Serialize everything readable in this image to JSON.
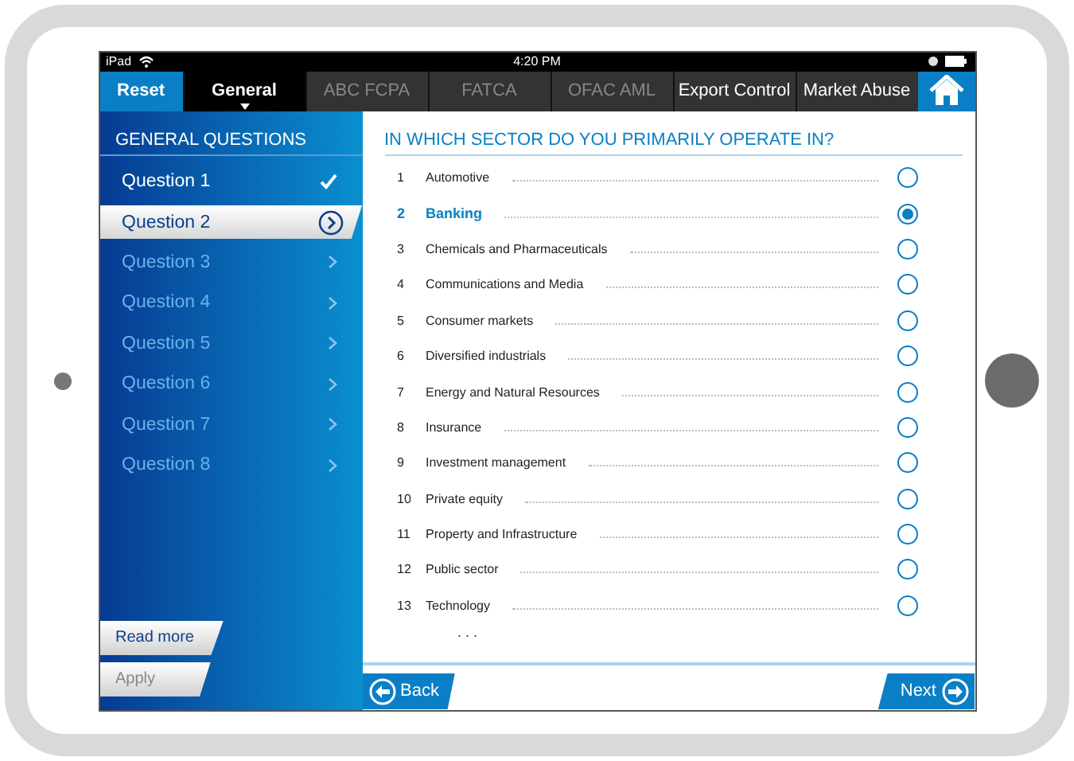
{
  "status_bar": {
    "device": "iPad",
    "time": "4:20 PM"
  },
  "nav": {
    "reset": "Reset",
    "tabs": [
      {
        "label": "General",
        "selected": true,
        "disabled": false
      },
      {
        "label": "ABC FCPA",
        "selected": false,
        "disabled": true
      },
      {
        "label": "FATCA",
        "selected": false,
        "disabled": true
      },
      {
        "label": "OFAC AML",
        "selected": false,
        "disabled": true
      },
      {
        "label": "Export Control",
        "selected": false,
        "disabled": false
      },
      {
        "label": "Market Abuse",
        "selected": false,
        "disabled": false
      }
    ]
  },
  "sidebar": {
    "title": "GENERAL QUESTIONS",
    "items": [
      {
        "label": "Question 1",
        "selected": false,
        "answered": true
      },
      {
        "label": "Question 2",
        "selected": true,
        "answered": false
      },
      {
        "label": "Question 3",
        "selected": false,
        "answered": false
      },
      {
        "label": "Question 4",
        "selected": false,
        "answered": false
      },
      {
        "label": "Question 5",
        "selected": false,
        "answered": false
      },
      {
        "label": "Question 6",
        "selected": false,
        "answered": false
      },
      {
        "label": "Question 7",
        "selected": false,
        "answered": false
      },
      {
        "label": "Question 8",
        "selected": false,
        "answered": false
      }
    ],
    "buttons": [
      {
        "label": "Read more",
        "disabled": false
      },
      {
        "label": "Apply",
        "disabled": true
      }
    ]
  },
  "question": {
    "title": "IN WHICH SECTOR DO YOU PRIMARILY OPERATE IN?",
    "options": [
      {
        "number": "1",
        "label": "Automotive",
        "selected": false
      },
      {
        "number": "2",
        "label": "Banking",
        "selected": true
      },
      {
        "number": "3",
        "label": "Chemicals and Pharmaceuticals",
        "selected": false
      },
      {
        "number": "4",
        "label": "Communications and Media",
        "selected": false
      },
      {
        "number": "5",
        "label": "Consumer markets",
        "selected": false
      },
      {
        "number": "6",
        "label": "Diversified industrials",
        "selected": false
      },
      {
        "number": "7",
        "label": "Energy and Natural Resources",
        "selected": false
      },
      {
        "number": "8",
        "label": "Insurance",
        "selected": false
      },
      {
        "number": "9",
        "label": "Investment management",
        "selected": false
      },
      {
        "number": "10",
        "label": "Private equity",
        "selected": false
      },
      {
        "number": "11",
        "label": "Property and Infrastructure",
        "selected": false
      },
      {
        "number": "12",
        "label": "Public sector",
        "selected": false
      },
      {
        "number": "13",
        "label": "Technology",
        "selected": false
      }
    ],
    "more": ". . ."
  },
  "footer": {
    "back": "Back",
    "next": "Next"
  }
}
